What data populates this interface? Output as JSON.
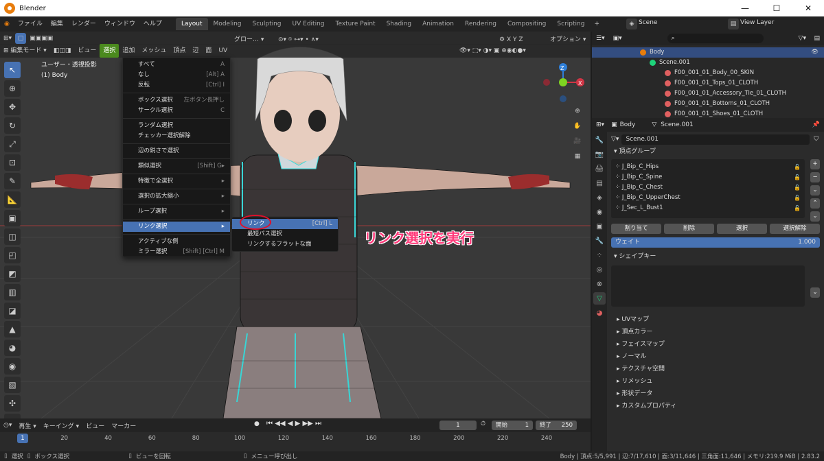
{
  "window": {
    "title": "Blender",
    "controls": [
      "—",
      "☐",
      "✕"
    ]
  },
  "topbar": {
    "menus": [
      "ファイル",
      "編集",
      "レンダー",
      "ウィンドウ",
      "ヘルプ"
    ],
    "tabs": [
      "Layout",
      "Modeling",
      "Sculpting",
      "UV Editing",
      "Texture Paint",
      "Shading",
      "Animation",
      "Rendering",
      "Compositing",
      "Scripting"
    ],
    "active_tab": "Layout",
    "scene": "Scene",
    "view_layer": "View Layer"
  },
  "viewport": {
    "toolbar1": {
      "transform": "グロー…",
      "options": "オプション",
      "axes": [
        "X",
        "Y",
        "Z"
      ]
    },
    "header": {
      "mode": "編集モード",
      "menus": [
        "ビュー",
        "選択",
        "追加",
        "メッシュ",
        "頂点",
        "辺",
        "面",
        "UV"
      ],
      "active_menu": "選択"
    },
    "info_line1": "ユーザー・透視投影",
    "info_line2": "(1) Body",
    "annotation": "リンク選択を実行",
    "gizmo": {
      "z": "Z",
      "x": "X"
    }
  },
  "select_menu": {
    "items": [
      {
        "label": "すべて",
        "shortcut": "A"
      },
      {
        "label": "なし",
        "shortcut": "[Alt] A"
      },
      {
        "label": "反転",
        "shortcut": "[Ctrl] I"
      },
      {
        "sep": true
      },
      {
        "label": "ボックス選択",
        "shortcut": "左ボタン長押し"
      },
      {
        "label": "サークル選択",
        "shortcut": "C"
      },
      {
        "sep": true
      },
      {
        "label": "ランダム選択",
        "shortcut": ""
      },
      {
        "label": "チェッカー選択解除",
        "shortcut": ""
      },
      {
        "sep": true
      },
      {
        "label": "辺の鋭さで選択",
        "shortcut": ""
      },
      {
        "sep": true
      },
      {
        "label": "類似選択",
        "shortcut": "[Shift] G▸"
      },
      {
        "sep": true
      },
      {
        "label": "特徴で全選択",
        "shortcut": "▸"
      },
      {
        "sep": true
      },
      {
        "label": "選択の拡大縮小",
        "shortcut": "▸"
      },
      {
        "sep": true
      },
      {
        "label": "ループ選択",
        "shortcut": "▸"
      },
      {
        "sep": true
      },
      {
        "label": "リンク選択",
        "shortcut": "▸",
        "highlight": true
      },
      {
        "sep": true
      },
      {
        "label": "アクティブな側",
        "shortcut": ""
      },
      {
        "label": "ミラー選択",
        "shortcut": "[Shift] [Ctrl] M"
      }
    ]
  },
  "link_submenu": {
    "items": [
      {
        "label": "リンク",
        "shortcut": "[Ctrl] L",
        "highlight": true
      },
      {
        "label": "最短パス選択",
        "shortcut": ""
      },
      {
        "label": "リンクするフラットな面",
        "shortcut": ""
      }
    ]
  },
  "timeline": {
    "menus": [
      "再生",
      "キーイング",
      "ビュー",
      "マーカー"
    ],
    "current_frame": "1",
    "start_label": "開始",
    "start": "1",
    "end_label": "終了",
    "end": "250",
    "ticks": [
      "1",
      "20",
      "40",
      "60",
      "80",
      "100",
      "120",
      "140",
      "160",
      "180",
      "200",
      "220",
      "240"
    ]
  },
  "statusbar": {
    "items": [
      "選択",
      "ボックス選択",
      "ビューを回転",
      "メニュー呼び出し"
    ],
    "stats": "Body | 頂点:5/5,991 | 辺:7/17,610 | 面:3/11,646 | 三角面:11,646 | メモリ:219.9 MiB | 2.83.2"
  },
  "outliner": {
    "rows": [
      {
        "label": "Body",
        "color": "#e87d0d",
        "indent": 70,
        "selected": true
      },
      {
        "label": "Scene.001",
        "color": "#1ed37a",
        "indent": 84
      },
      {
        "label": "F00_001_01_Body_00_SKIN",
        "color": "#e06060",
        "indent": 106
      },
      {
        "label": "F00_001_01_Tops_01_CLOTH",
        "color": "#e06060",
        "indent": 106
      },
      {
        "label": "F00_001_01_Accessory_Tie_01_CLOTH",
        "color": "#e06060",
        "indent": 106
      },
      {
        "label": "F00_001_01_Bottoms_01_CLOTH",
        "color": "#e06060",
        "indent": 106
      },
      {
        "label": "F00_001_01_Shoes_01_CLOTH",
        "color": "#e06060",
        "indent": 106
      }
    ]
  },
  "properties": {
    "object": "Body",
    "mesh": "Scene.001",
    "mesh_field": "Scene.001",
    "vertex_groups_title": "頂点グループ",
    "vertex_groups": [
      "J_Bip_C_Hips",
      "J_Bip_C_Spine",
      "J_Bip_C_Chest",
      "J_Bip_C_UpperChest",
      "J_Sec_L_Bust1"
    ],
    "vg_buttons": [
      "割り当て",
      "削除",
      "選択",
      "選択解除"
    ],
    "weight_label": "ウェイト",
    "weight_value": "1.000",
    "shape_keys_title": "シェイプキー",
    "sections": [
      "UVマップ",
      "頂点カラー",
      "フェイスマップ",
      "ノーマル",
      "テクスチャ空間",
      "リメッシュ",
      "形状データ",
      "カスタムプロパティ"
    ]
  }
}
